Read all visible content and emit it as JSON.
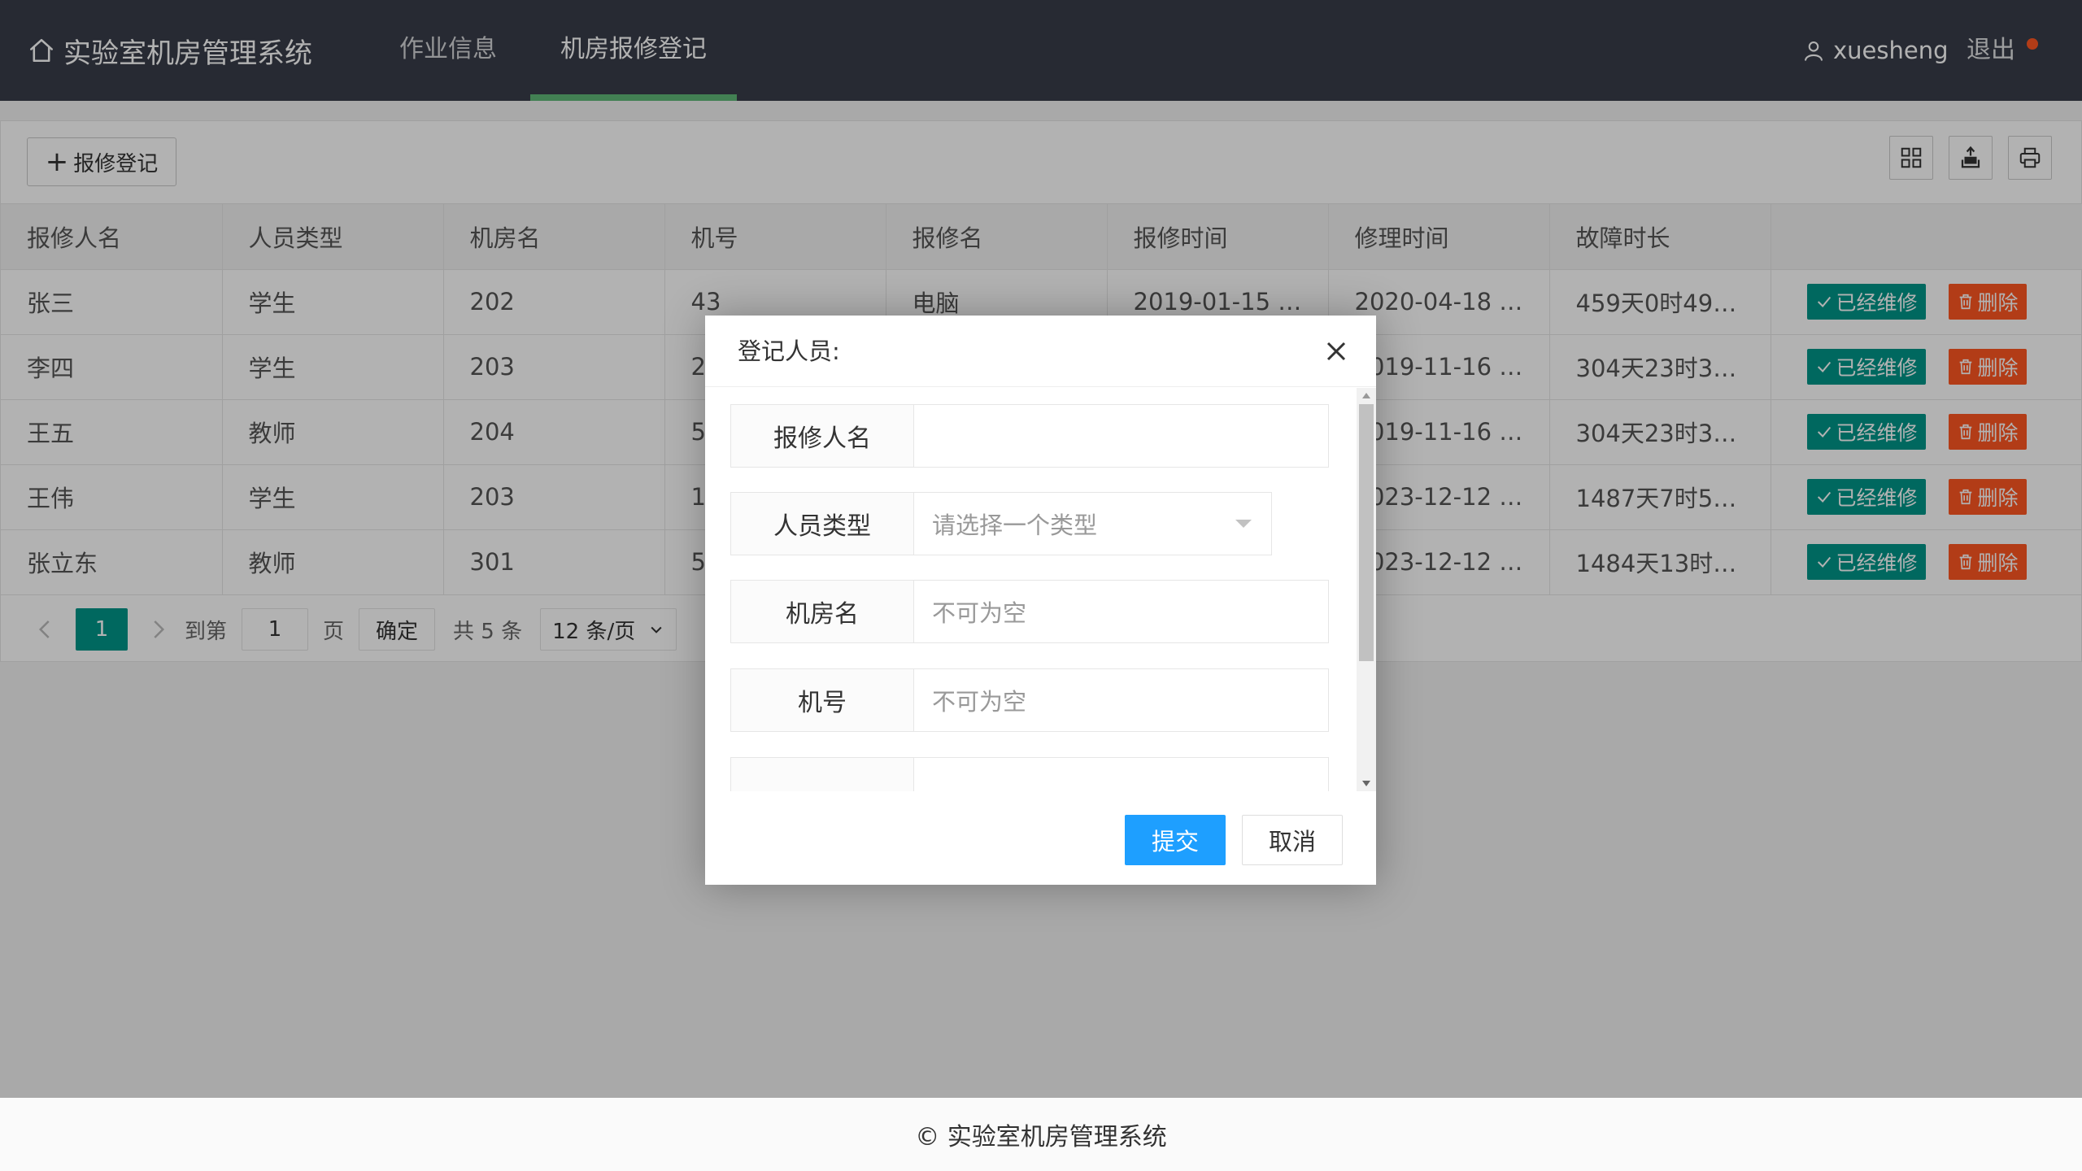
{
  "header": {
    "brand_title": "实验室机房管理系统",
    "nav": [
      {
        "label": "作业信息",
        "active": false
      },
      {
        "label": "机房报修登记",
        "active": true
      }
    ],
    "username": "xuesheng",
    "logout_label": "退出",
    "accent_color": "#5fb878"
  },
  "toolbar": {
    "add_label": "报修登记",
    "tools": [
      "columns-icon",
      "export-icon",
      "print-icon"
    ]
  },
  "table": {
    "columns": [
      "报修人名",
      "人员类型",
      "机房名",
      "机号",
      "报修名",
      "报修时间",
      "修理时间",
      "故障时长",
      ""
    ],
    "rows": [
      [
        "张三",
        "学生",
        "202",
        "43",
        "电脑",
        "2019-01-15 1…",
        "2020-04-18 1…",
        "459天0时49…"
      ],
      [
        "李四",
        "学生",
        "203",
        "2",
        "",
        "",
        "2019-11-16 1…",
        "304天23时32…"
      ],
      [
        "王五",
        "教师",
        "204",
        "5",
        "",
        "",
        "2019-11-16 1…",
        "304天23时32…"
      ],
      [
        "王伟",
        "学生",
        "203",
        "1",
        "",
        "",
        "2023-12-12 2…",
        "1487天7时52…"
      ],
      [
        "张立东",
        "教师",
        "301",
        "5",
        "",
        "",
        "2023-12-12 2…",
        "1484天13时3…"
      ]
    ],
    "done_label": "已经维修",
    "delete_label": "删除",
    "done_color": "#009688",
    "delete_color": "#ff5722"
  },
  "pager": {
    "current_page": "1",
    "goto_prefix": "到第",
    "goto_value": "1",
    "goto_suffix": "页",
    "confirm_label": "确定",
    "total_label": "共 5 条",
    "page_size": "12 条/页"
  },
  "footer": {
    "text": "© 实验室机房管理系统"
  },
  "modal": {
    "title": "登记人员:",
    "fields": [
      {
        "label": "报修人名",
        "value": "",
        "placeholder": ""
      },
      {
        "label": "人员类型",
        "value": "",
        "placeholder": "请选择一个类型"
      },
      {
        "label": "机房名",
        "value": "",
        "placeholder": "不可为空"
      },
      {
        "label": "机号",
        "value": "",
        "placeholder": "不可为空"
      }
    ],
    "submit_label": "提交",
    "cancel_label": "取消",
    "submit_color": "#1e9fff"
  }
}
